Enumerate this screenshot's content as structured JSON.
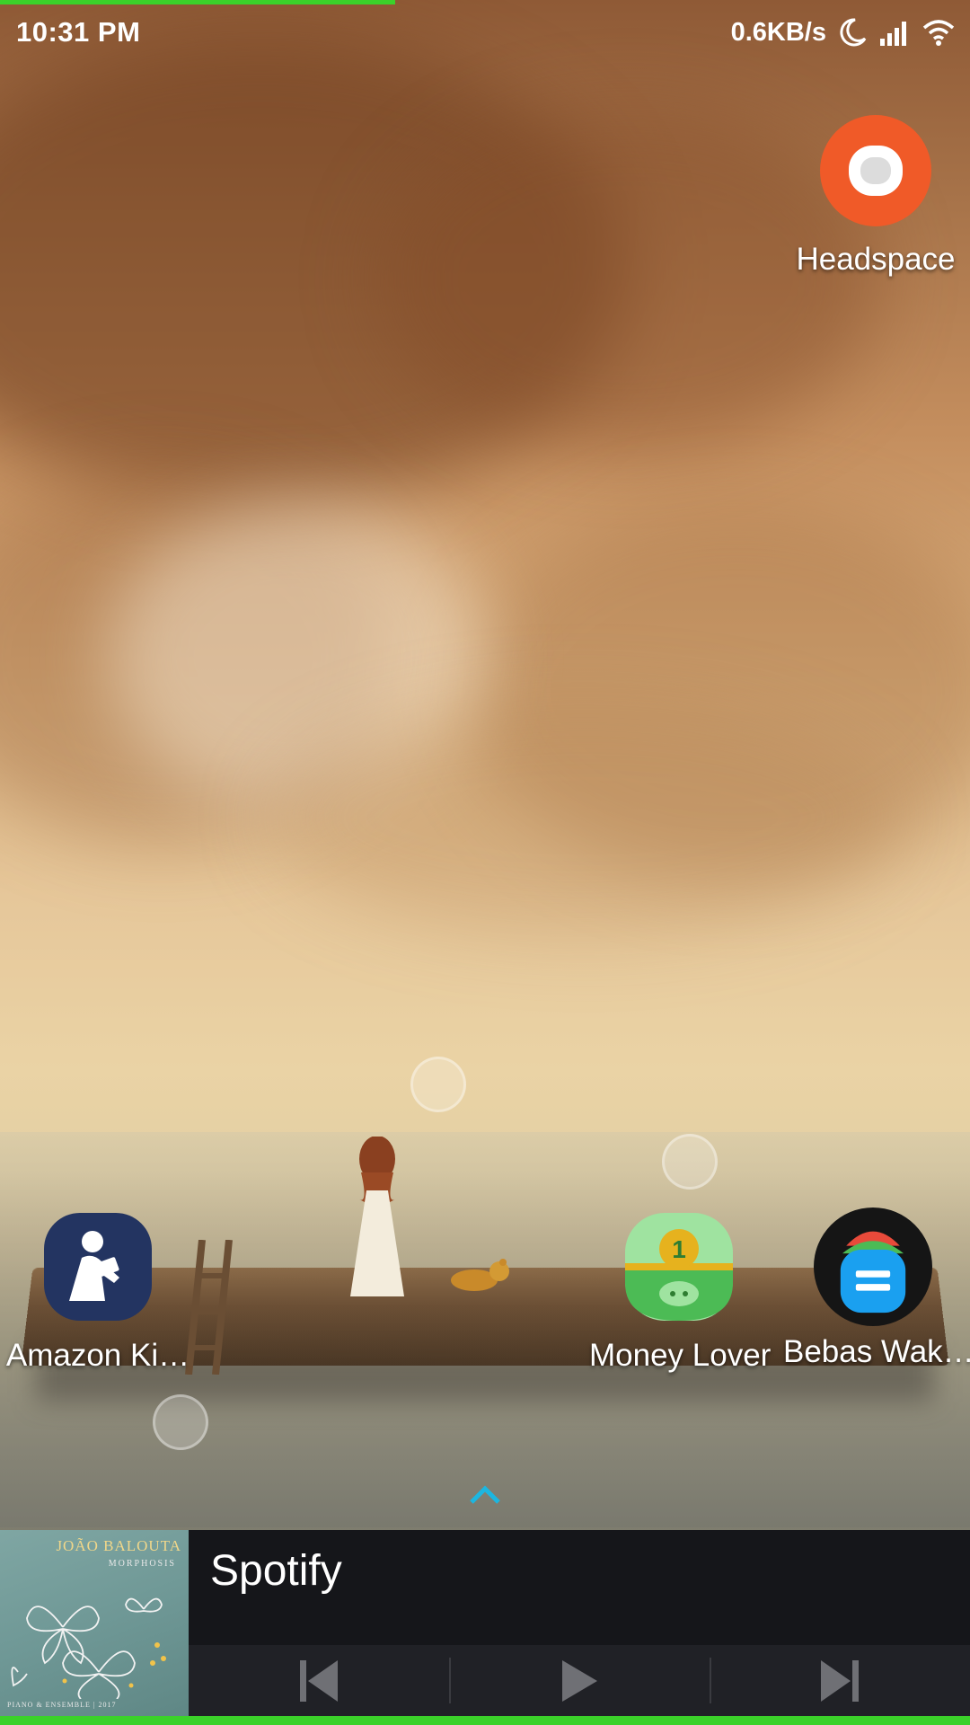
{
  "status_bar": {
    "time": "10:31 PM",
    "net_speed": "0.6KB/s",
    "icons": [
      "moon-icon",
      "signal-icon",
      "wifi-icon"
    ]
  },
  "home_apps": [
    {
      "label": "Headspace",
      "icon": "headspace-icon"
    },
    {
      "label": "Amazon Ki…",
      "icon": "kindle-icon"
    },
    {
      "label": "Money Lover",
      "icon": "money-lover-icon"
    },
    {
      "label": "Bebas Wak…",
      "icon": "bebas-wak-icon"
    }
  ],
  "drawer_indicator": "chevron-up-icon",
  "music_widget": {
    "app_name": "Spotify",
    "album_art": {
      "artist": "JOÃO BALOUTA",
      "title": "MORPHOSIS",
      "footer": "PIANO & ENSEMBLE | 2017"
    },
    "controls": [
      "previous-icon",
      "play-icon",
      "next-icon"
    ]
  },
  "colors": {
    "accent_green": "#3bd12a",
    "headspace_orange": "#f05a28",
    "kindle_navy": "#233461",
    "money_lover_green": "#4cbb55",
    "bebas_blue": "#1aa0f0",
    "widget_bg": "#15161a"
  }
}
